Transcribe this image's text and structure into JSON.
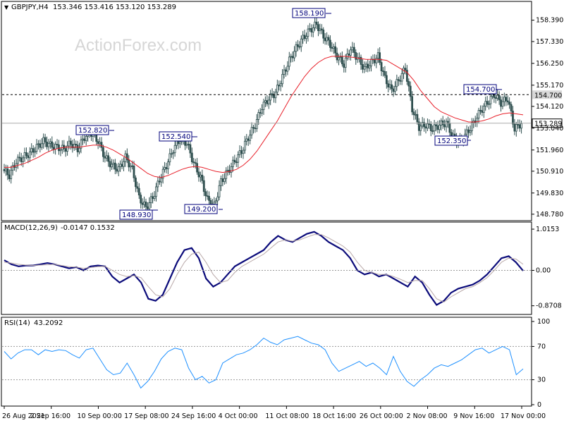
{
  "header": {
    "symbol": "GBPJPY,H4",
    "ohlc": "153.346 153.416 153.120 153.289"
  },
  "watermark": "ActionForex.com",
  "colors": {
    "candle": "#2f4f4f",
    "ma": "#e8202a",
    "macd": "#0b0b7a",
    "signal": "#b8a8a8",
    "rsi": "#1e90ff",
    "annotation": "#00007b",
    "price_tag_bg": "#d8d8d8"
  },
  "chart_data": [
    {
      "type": "candlestick",
      "title": "GBPJPY,H4",
      "ohlc_text": "153.346 153.416 153.120 153.289",
      "y_ticks": [
        "158.390",
        "157.330",
        "156.250",
        "155.170",
        "154.120",
        "153.040",
        "151.960",
        "150.910",
        "149.830",
        "148.780"
      ],
      "y_tick_values": [
        158.39,
        157.33,
        156.25,
        155.17,
        154.12,
        153.04,
        151.96,
        150.91,
        149.83,
        148.78
      ],
      "ylim": [
        148.6,
        158.9
      ],
      "x_ticks": [
        "26 Aug 2021",
        "2 Sep 16:00",
        "10 Sep 00:00",
        "17 Sep 08:00",
        "24 Sep 16:00",
        "4 Oct 00:00",
        "11 Oct 08:00",
        "18 Oct 16:00",
        "26 Oct 00:00",
        "2 Nov 08:00",
        "9 Nov 16:00",
        "17 Nov 00:00"
      ],
      "horizontal_lines": [
        {
          "value": 154.7,
          "label": "154.700",
          "style": "dashed"
        },
        {
          "value": 153.289,
          "label": "153.289",
          "style": "solid"
        }
      ],
      "annotations": [
        {
          "label": "152.820",
          "value": 152.82
        },
        {
          "label": "148.930",
          "value": 148.93
        },
        {
          "label": "152.540",
          "value": 152.54
        },
        {
          "label": "149.200",
          "value": 149.2
        },
        {
          "label": "158.190",
          "value": 158.19
        },
        {
          "label": "154.700",
          "value": 154.7
        },
        {
          "label": "152.350",
          "value": 152.35
        }
      ],
      "price_path_closes": [
        151.0,
        150.7,
        151.4,
        151.6,
        151.8,
        152.1,
        152.4,
        152.2,
        152.1,
        152.0,
        152.3,
        152.0,
        152.6,
        152.8,
        152.4,
        151.6,
        151.2,
        151.0,
        151.6,
        151.0,
        149.6,
        149.1,
        149.6,
        150.5,
        151.2,
        152.0,
        152.5,
        152.3,
        151.3,
        150.6,
        149.5,
        149.2,
        150.4,
        150.9,
        151.4,
        151.9,
        152.6,
        153.2,
        154.1,
        154.5,
        154.8,
        155.6,
        156.4,
        157.0,
        157.5,
        157.9,
        158.19,
        157.6,
        157.2,
        156.6,
        156.2,
        157.0,
        156.5,
        156.0,
        156.3,
        156.6,
        155.5,
        154.9,
        155.4,
        156.0,
        154.0,
        153.1,
        153.2,
        153.0,
        153.2,
        153.3,
        152.6,
        152.35,
        152.8,
        153.3,
        153.9,
        154.3,
        154.7,
        154.3,
        154.5,
        153.0,
        153.289
      ],
      "ma_values": [
        151.1,
        151.1,
        151.2,
        151.3,
        151.45,
        151.6,
        151.8,
        151.95,
        152.05,
        152.1,
        152.1,
        152.1,
        152.15,
        152.2,
        152.2,
        152.1,
        151.95,
        151.75,
        151.55,
        151.3,
        151.05,
        150.8,
        150.65,
        150.6,
        150.7,
        150.85,
        151.0,
        151.1,
        151.15,
        151.1,
        151.0,
        150.9,
        150.85,
        150.9,
        151.0,
        151.2,
        151.5,
        151.9,
        152.4,
        152.9,
        153.4,
        154.0,
        154.6,
        155.1,
        155.6,
        156.0,
        156.3,
        156.5,
        156.6,
        156.6,
        156.6,
        156.55,
        156.5,
        156.45,
        156.45,
        156.45,
        156.4,
        156.2,
        156.0,
        155.8,
        155.4,
        154.9,
        154.5,
        154.1,
        153.85,
        153.7,
        153.55,
        153.45,
        153.35,
        153.35,
        153.4,
        153.5,
        153.65,
        153.75,
        153.8,
        153.75,
        153.7
      ]
    },
    {
      "type": "line",
      "title": "MACD(12,26,9)",
      "values_text": "-0.0147 0.1532",
      "y_ticks": [
        "1.0153",
        "0.00",
        "-0.8708"
      ],
      "y_tick_values": [
        1.0153,
        0.0,
        -0.8708
      ],
      "ylim": [
        -1.05,
        1.12
      ],
      "series": [
        {
          "name": "MACD",
          "values": [
            0.25,
            0.15,
            0.1,
            0.12,
            0.12,
            0.15,
            0.18,
            0.15,
            0.1,
            0.05,
            0.08,
            0.0,
            0.1,
            0.12,
            0.1,
            -0.15,
            -0.3,
            -0.2,
            -0.1,
            -0.3,
            -0.7,
            -0.75,
            -0.6,
            -0.2,
            0.2,
            0.5,
            0.55,
            0.3,
            -0.2,
            -0.4,
            -0.3,
            -0.1,
            0.1,
            0.2,
            0.3,
            0.4,
            0.5,
            0.7,
            0.85,
            0.75,
            0.7,
            0.8,
            0.9,
            0.95,
            0.85,
            0.7,
            0.6,
            0.5,
            0.3,
            0.0,
            -0.1,
            -0.05,
            -0.15,
            -0.1,
            -0.2,
            -0.3,
            -0.4,
            -0.15,
            -0.3,
            -0.6,
            -0.85,
            -0.75,
            -0.55,
            -0.45,
            -0.4,
            -0.35,
            -0.25,
            -0.1,
            0.1,
            0.3,
            0.35,
            0.2,
            -0.01
          ]
        },
        {
          "name": "Signal",
          "values": [
            0.2,
            0.18,
            0.15,
            0.13,
            0.12,
            0.13,
            0.14,
            0.15,
            0.12,
            0.09,
            0.08,
            0.05,
            0.07,
            0.09,
            0.1,
            0.0,
            -0.1,
            -0.15,
            -0.13,
            -0.18,
            -0.4,
            -0.6,
            -0.65,
            -0.45,
            -0.1,
            0.2,
            0.4,
            0.45,
            0.2,
            -0.1,
            -0.3,
            -0.25,
            -0.05,
            0.1,
            0.2,
            0.3,
            0.4,
            0.55,
            0.7,
            0.75,
            0.72,
            0.75,
            0.82,
            0.88,
            0.88,
            0.8,
            0.7,
            0.6,
            0.45,
            0.2,
            0.0,
            -0.05,
            -0.1,
            -0.1,
            -0.15,
            -0.22,
            -0.3,
            -0.25,
            -0.25,
            -0.45,
            -0.7,
            -0.78,
            -0.65,
            -0.55,
            -0.45,
            -0.4,
            -0.3,
            -0.18,
            0.0,
            0.2,
            0.3,
            0.28,
            0.15
          ]
        }
      ]
    },
    {
      "type": "line",
      "title": "RSI(14)",
      "values_text": "43.2092",
      "y_ticks": [
        "100",
        "70",
        "30",
        "0"
      ],
      "y_tick_values": [
        100,
        70,
        30,
        0
      ],
      "ylim": [
        0,
        100
      ],
      "levels": [
        70,
        30
      ],
      "series": [
        {
          "name": "RSI",
          "values": [
            64,
            55,
            62,
            66,
            66,
            60,
            66,
            64,
            66,
            65,
            60,
            56,
            66,
            68,
            55,
            42,
            36,
            38,
            50,
            36,
            20,
            28,
            40,
            55,
            64,
            68,
            66,
            44,
            30,
            34,
            26,
            30,
            50,
            55,
            60,
            62,
            66,
            72,
            80,
            75,
            72,
            78,
            80,
            82,
            78,
            74,
            72,
            66,
            50,
            40,
            44,
            48,
            52,
            46,
            50,
            44,
            36,
            58,
            40,
            28,
            22,
            30,
            36,
            44,
            48,
            46,
            50,
            54,
            60,
            66,
            68,
            62,
            66,
            70,
            66,
            36,
            43
          ]
        }
      ]
    }
  ]
}
